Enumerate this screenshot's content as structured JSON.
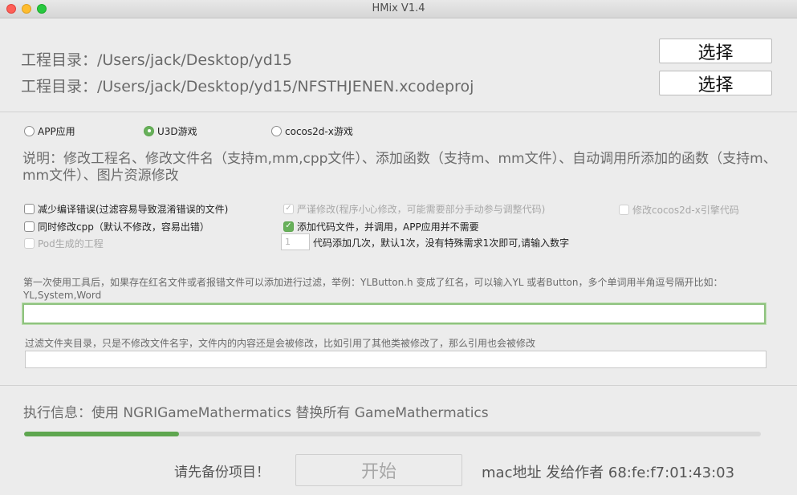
{
  "window": {
    "title": "HMix V1.4"
  },
  "paths": {
    "project_dir_1": "工程目录：/Users/jack/Desktop/yd15",
    "project_dir_2": "工程目录：/Users/jack/Desktop/yd15/NFSTHJENEN.xcodeproj",
    "choose_button_1": "选择",
    "choose_button_2": "选择"
  },
  "mode": {
    "options": [
      {
        "label": "APP应用",
        "selected": false
      },
      {
        "label": "U3D游戏",
        "selected": true
      },
      {
        "label": "cocos2d-x游戏",
        "selected": false
      }
    ]
  },
  "description": "说明：修改工程名、修改文件名（支持m,mm,cpp文件）、添加函数（支持m、mm文件）、自动调用所添加的函数（支持m、mm文件）、图片资源修改",
  "options": {
    "reduce_compile_errors": {
      "label": "减少编译错误(过滤容易导致混淆错误的文件)",
      "checked": false,
      "enabled": true
    },
    "modify_cpp": {
      "label": "同时修改cpp（默认不修改，容易出错）",
      "checked": false,
      "enabled": true
    },
    "pod_project": {
      "label": "Pod生成的工程",
      "checked": false,
      "enabled": false
    },
    "strict_modify": {
      "label": "严谨修改(程序小心修改，可能需要部分手动参与调整代码)",
      "checked": true,
      "enabled": false
    },
    "add_code_files": {
      "label": "添加代码文件，并调用，APP应用并不需要",
      "checked": true,
      "enabled": true
    },
    "modify_cocos_engine": {
      "label": "修改cocos2d-x引擎代码",
      "checked": false,
      "enabled": false
    }
  },
  "code_add_times": {
    "placeholder": "1",
    "label": "代码添加几次，默认1次，没有特殊需求1次即可,请输入数字"
  },
  "filter_names": {
    "hint": "第一次使用工具后，如果存在红名文件或者报错文件可以添加进行过滤，举例：YLButton.h 变成了红名，可以输入YL 或者Button，多个单词用半角逗号隔开比如：YL,System,Word",
    "value": ""
  },
  "filter_dirs": {
    "hint": "过滤文件夹目录，只是不修改文件名字，文件内的内容还是会被修改，比如引用了其他类被修改了，那么引用也会被修改",
    "value": ""
  },
  "execution": {
    "info": "执行信息：使用 NGRIGameMathermatics 替换所有 GameMathermatics",
    "progress": 0.21
  },
  "footer": {
    "warning": "请先备份项目！",
    "start_button": "开始",
    "mac_info": "mac地址 发给作者 68:fe:f7:01:43:03"
  }
}
